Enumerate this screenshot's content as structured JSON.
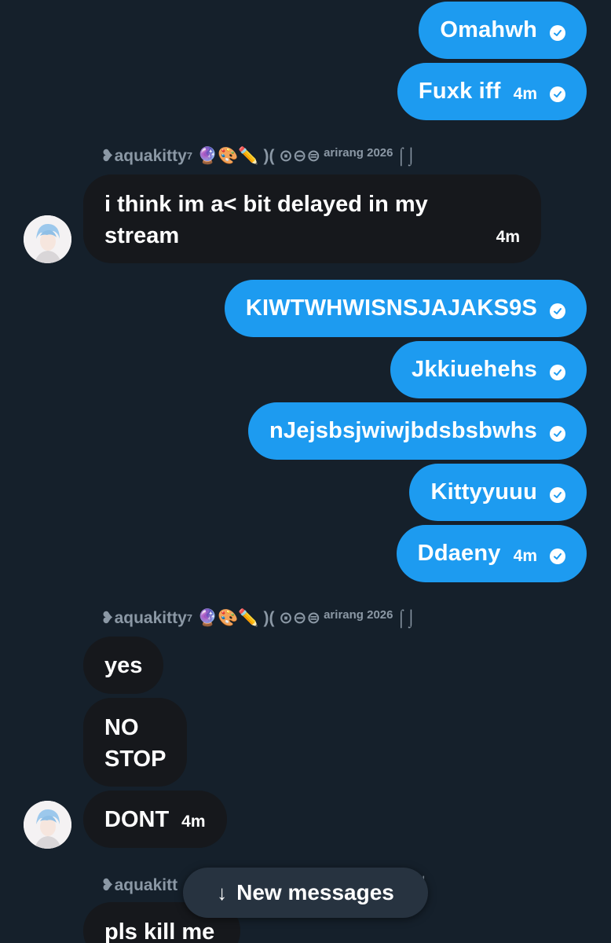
{
  "colors": {
    "background": "#15202b",
    "outgoing_bubble": "#1d9bf0",
    "incoming_bubble": "#16181c",
    "meta_text": "#8b98a5"
  },
  "messages_top": {
    "m1": {
      "text": "Omahwh"
    },
    "m2": {
      "text": "Fuxk iff",
      "time": "4m"
    }
  },
  "sender_header": {
    "name": "❥aquakitty",
    "superscript": "7",
    "emojis": "🔮🎨✏️",
    "deco": ")( ⊙⊖⊜",
    "small_text": "arirang 2026",
    "suffix": "⌠⌡"
  },
  "incoming_1": {
    "line1": "i think im a< bit delayed in my",
    "line2": "stream",
    "time": "4m"
  },
  "messages_mid": {
    "m3": {
      "text": "KIWTWHWISNSJAJAKS9S"
    },
    "m4": {
      "text": "Jkkiuehehs"
    },
    "m5": {
      "text": "nJejsbsjwiwjbdsbsbwhs"
    },
    "m6": {
      "text": "Kittyyuuu"
    },
    "m7": {
      "text": "Ddaeny",
      "time": "4m"
    }
  },
  "incoming_group_2": {
    "yes": "yes",
    "no_line1": "NO",
    "no_line2": "STOP",
    "dont": "DONT",
    "dont_time": "4m"
  },
  "partial_sender": "❥aquakitt",
  "partial_message": "pls kill me",
  "new_messages": {
    "arrow": "↓",
    "label": "New messages"
  }
}
